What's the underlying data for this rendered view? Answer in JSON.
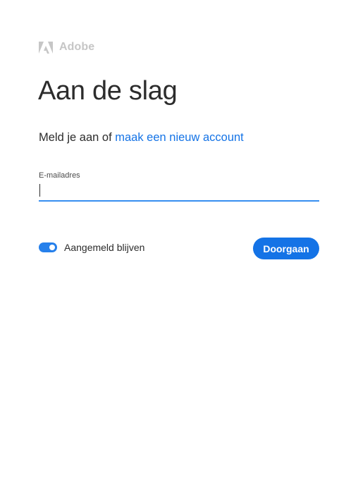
{
  "brand": {
    "name": "Adobe",
    "logo_icon": "adobe-logo-icon",
    "color": "#c6c6c6"
  },
  "title": "Aan de slag",
  "subtitle": {
    "prefix": "Meld je aan of ",
    "link": "maak een nieuw account",
    "link_color": "#1473e6"
  },
  "email": {
    "label": "E-mailadres",
    "value": "",
    "placeholder": "",
    "underline_color": "#378ef0"
  },
  "remember": {
    "label": "Aangemeld blijven",
    "checked": true,
    "color": "#2680eb"
  },
  "continue_button": {
    "label": "Doorgaan",
    "color": "#1473e6"
  }
}
